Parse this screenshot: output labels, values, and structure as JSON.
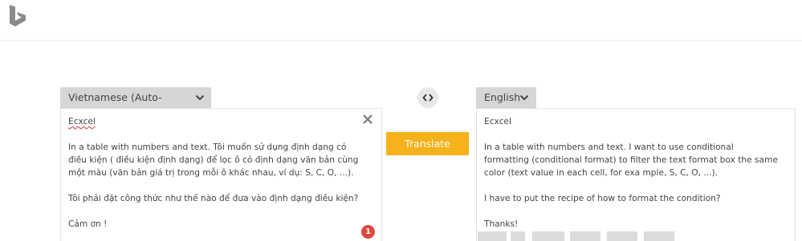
{
  "source": {
    "language_label": "Vietnamese (Auto-Detected)",
    "paragraphs": [
      "Ecxcel",
      "In a table with numbers and text. Tôi muốn sử dụng định dạng có điều kiện ( điều kiện định dạng) để lọc ô có định dạng văn bản cùng một màu (văn bản giá trị trong mỗi ô khác nhau, ví dụ: S, C, O, ...).",
      "Tôi phải đặt công thức như thế nào để đưa vào định dạng điều kiện?",
      "Cảm ơn !"
    ],
    "notification_count": "1"
  },
  "target": {
    "language_label": "English",
    "paragraphs": [
      "Ecxcel",
      "In a table with numbers and text. I want to use conditional formatting (conditional format) to filter the text format box the same color (text value in each cell, for exa mple, S, C, O, ...).",
      "I have to put the recipe of how to format the condition?",
      "Thanks!"
    ]
  },
  "translate_button_label": "Translate",
  "colors": {
    "accent": "#f6b21b",
    "tab_bg": "#d6d6d6",
    "badge": "#e0483e",
    "logo": "#8a8a8a"
  },
  "icons": {
    "logo": "bing-logo-icon",
    "swap": "swap-arrows-icon",
    "clear": "close-icon",
    "dropdown": "chevron-down-icon"
  }
}
